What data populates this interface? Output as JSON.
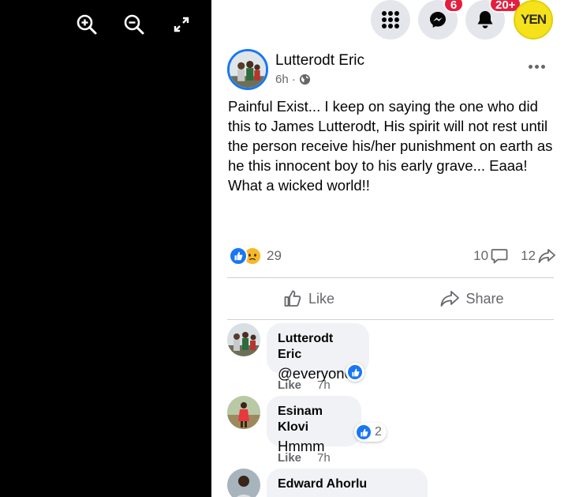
{
  "viewer": {
    "zoom_in_icon": "zoom-in-icon",
    "zoom_out_icon": "zoom-out-icon",
    "fullscreen_icon": "expand-icon"
  },
  "topbar": {
    "messenger_badge": "6",
    "notifications_badge": "20+",
    "account_label": "YEN"
  },
  "post": {
    "author": "Lutterodt Eric",
    "time": "6h ·",
    "text": "Painful Exist... I keep on saying the one who did this to James Lutterodt, His spirit will not rest until the person receive his/her punishment on earth as he this innocent boy to his early grave... Eaaa!\nWhat a wicked world!!",
    "reaction_count": "29",
    "comment_count": "10",
    "share_count": "12"
  },
  "actions": {
    "like_label": "Like",
    "share_label": "Share"
  },
  "comments": [
    {
      "name": "Lutterodt Eric",
      "text": "@everyone",
      "like": "Like",
      "time": "7h",
      "reactions": ""
    },
    {
      "name": "Esinam Klovi",
      "text": "Hmmm",
      "like": "Like",
      "time": "7h",
      "reactions": "2"
    },
    {
      "name": "Edward Ahorlu",
      "text": "",
      "like": "",
      "time": "",
      "reactions": ""
    }
  ],
  "colors": {
    "accent": "#1877f2",
    "badge": "#e41e3f",
    "muted": "#65676b",
    "bubble": "#f0f2f5"
  }
}
